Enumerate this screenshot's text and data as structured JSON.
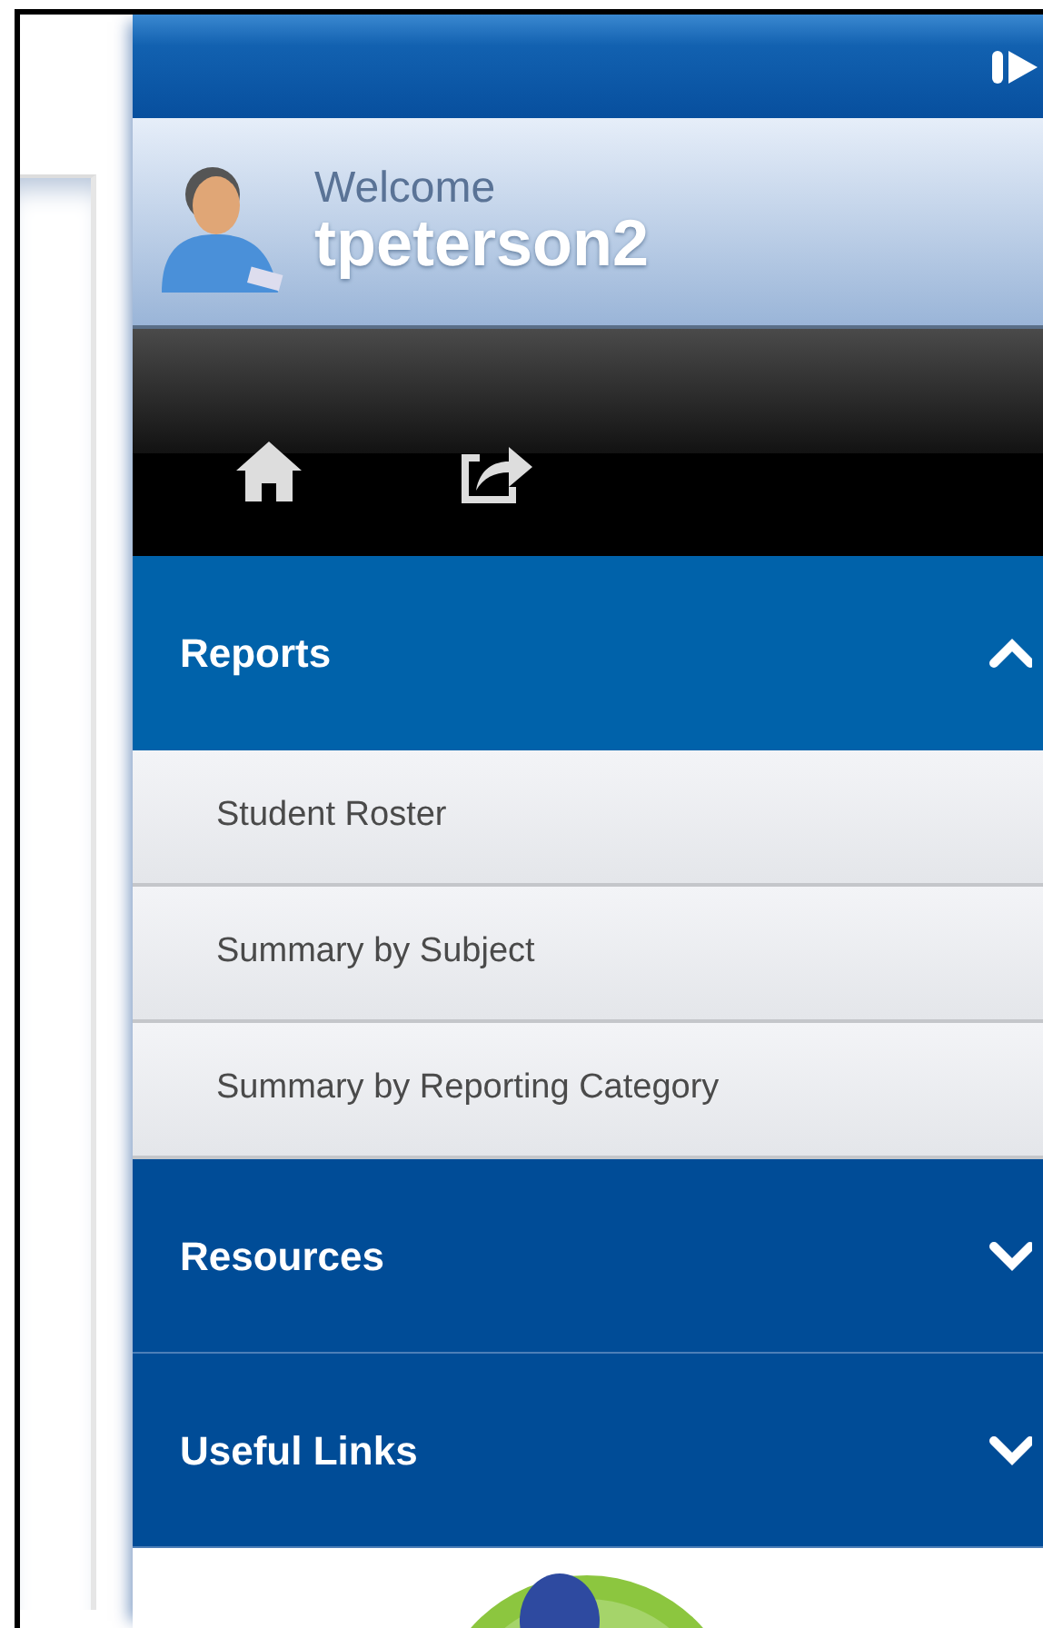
{
  "welcome": {
    "greeting": "Welcome",
    "username": "tpeterson2"
  },
  "sections": [
    {
      "title": "Reports",
      "expanded": true,
      "items": [
        "Student Roster",
        "Summary by Subject",
        "Summary by Reporting Category"
      ]
    },
    {
      "title": "Resources",
      "expanded": false
    },
    {
      "title": "Useful Links",
      "expanded": false
    }
  ]
}
